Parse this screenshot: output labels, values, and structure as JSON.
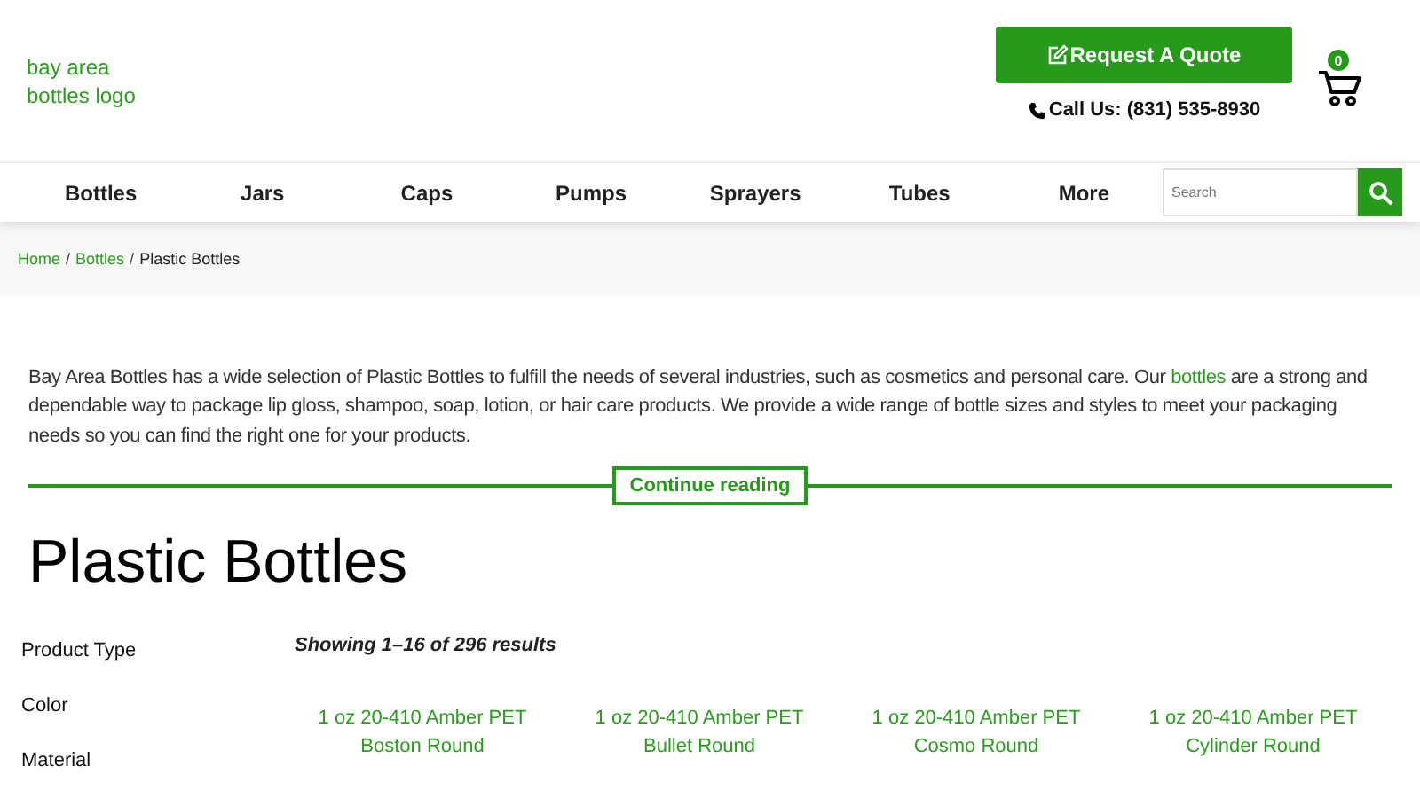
{
  "logo": "bay area bottles logo",
  "quote_button": "Request A Quote",
  "phone": "Call Us: (831) 535-8930",
  "cart": {
    "count": "0"
  },
  "nav": [
    "Bottles",
    "Jars",
    "Caps",
    "Pumps",
    "Sprayers",
    "Tubes",
    "More"
  ],
  "search": {
    "placeholder": "Search"
  },
  "breadcrumb_separator": "/",
  "breadcrumb": [
    {
      "label": "Home",
      "link": true
    },
    {
      "label": "Bottles",
      "link": true
    },
    {
      "label": "Plastic Bottles",
      "link": false
    }
  ],
  "intro": {
    "before": "Bay Area Bottles has a wide selection of Plastic Bottles to fulfill the needs of several industries, such as cosmetics and personal care. Our ",
    "link": "bottles",
    "after": " are a strong and dependable way to package lip gloss, shampoo, soap, lotion, or hair care products. We provide a wide range of bottle sizes and styles to meet your packaging needs so you can find the right one for your products."
  },
  "continue_button": "Continue reading",
  "heading": "Plastic Bottles",
  "filters": [
    "Product Type",
    "Color",
    "Material"
  ],
  "result_count": "Showing 1–16 of 296 results",
  "products": [
    "1 oz 20-410 Amber PET Boston Round",
    "1 oz 20-410 Amber PET Bullet Round",
    "1 oz 20-410 Amber PET Cosmo Round",
    "1 oz 20-410 Amber PET Cylinder Round"
  ]
}
